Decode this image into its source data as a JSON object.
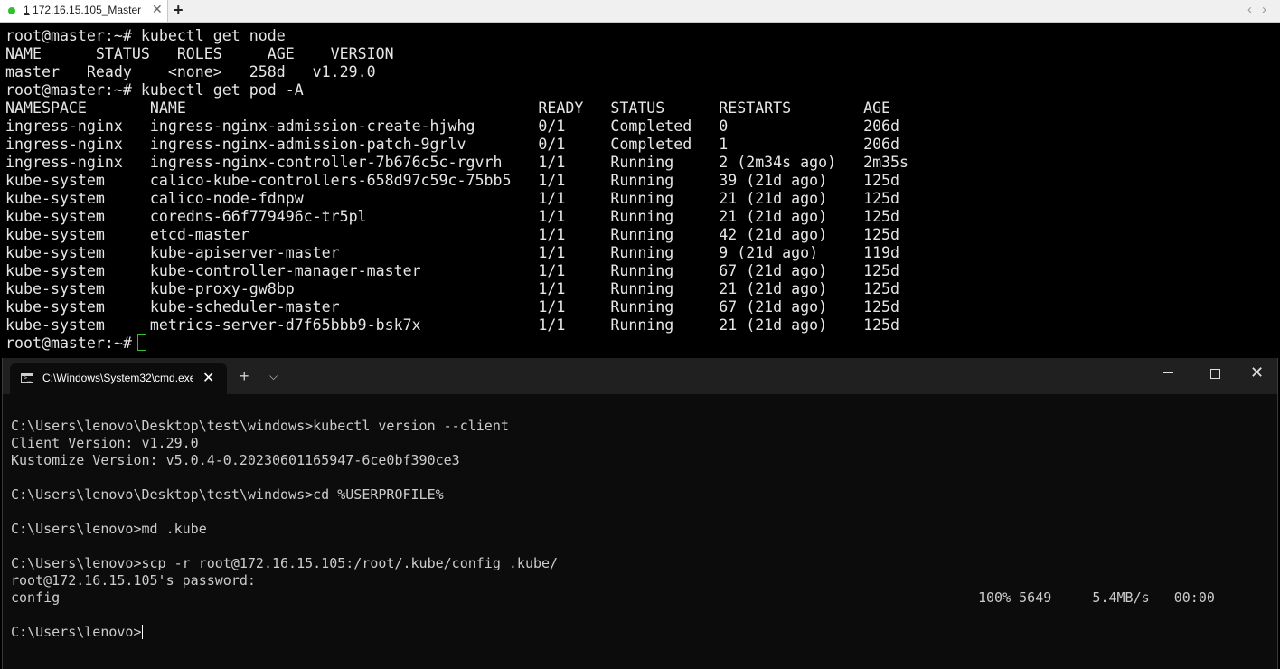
{
  "top_terminal": {
    "tab_number": "1",
    "tab_label": " 172.16.15.105_Master",
    "tab_close": "✕",
    "add_tab": "+",
    "nav_left": "‹",
    "nav_right": "›",
    "lines": [
      "root@master:~# kubectl get node",
      "NAME      STATUS   ROLES     AGE    VERSION",
      "master   Ready    <none>   258d   v1.29.0",
      "root@master:~# kubectl get pod -A",
      "NAMESPACE       NAME                                       READY   STATUS      RESTARTS        AGE",
      "ingress-nginx   ingress-nginx-admission-create-hjwhg       0/1     Completed   0               206d",
      "ingress-nginx   ingress-nginx-admission-patch-9grlv        0/1     Completed   1               206d",
      "ingress-nginx   ingress-nginx-controller-7b676c5c-rgvrh    1/1     Running     2 (2m34s ago)   2m35s",
      "kube-system     calico-kube-controllers-658d97c59c-75bb5   1/1     Running     39 (21d ago)    125d",
      "kube-system     calico-node-fdnpw                          1/1     Running     21 (21d ago)    125d",
      "kube-system     coredns-66f779496c-tr5pl                   1/1     Running     21 (21d ago)    125d",
      "kube-system     etcd-master                                1/1     Running     42 (21d ago)    125d",
      "kube-system     kube-apiserver-master                      1/1     Running     9 (21d ago)     119d",
      "kube-system     kube-controller-manager-master             1/1     Running     67 (21d ago)    125d",
      "kube-system     kube-proxy-gw8bp                           1/1     Running     21 (21d ago)    125d",
      "kube-system     kube-scheduler-master                      1/1     Running     67 (21d ago)    125d",
      "kube-system     metrics-server-d7f65bbb9-bsk7x             1/1     Running     21 (21d ago)    125d"
    ],
    "prompt": "root@master:~#"
  },
  "cmd_window": {
    "tab_title": "C:\\Windows\\System32\\cmd.exe",
    "tab_close": "✕",
    "new_tab": "+",
    "dropdown": "⌵",
    "close": "✕",
    "lines": [
      "C:\\Users\\lenovo\\Desktop\\test\\windows>kubectl version --client",
      "Client Version: v1.29.0",
      "Kustomize Version: v5.0.4-0.20230601165947-6ce0bf390ce3",
      "",
      "C:\\Users\\lenovo\\Desktop\\test\\windows>cd %USERPROFILE%",
      "",
      "C:\\Users\\lenovo>md .kube",
      "",
      "C:\\Users\\lenovo>scp -r root@172.16.15.105:/root/.kube/config .kube/",
      "root@172.16.15.105's password:",
      "config"
    ],
    "transfer_stats": "100% 5649     5.4MB/s   00:00",
    "prompt": "C:\\Users\\lenovo>"
  }
}
